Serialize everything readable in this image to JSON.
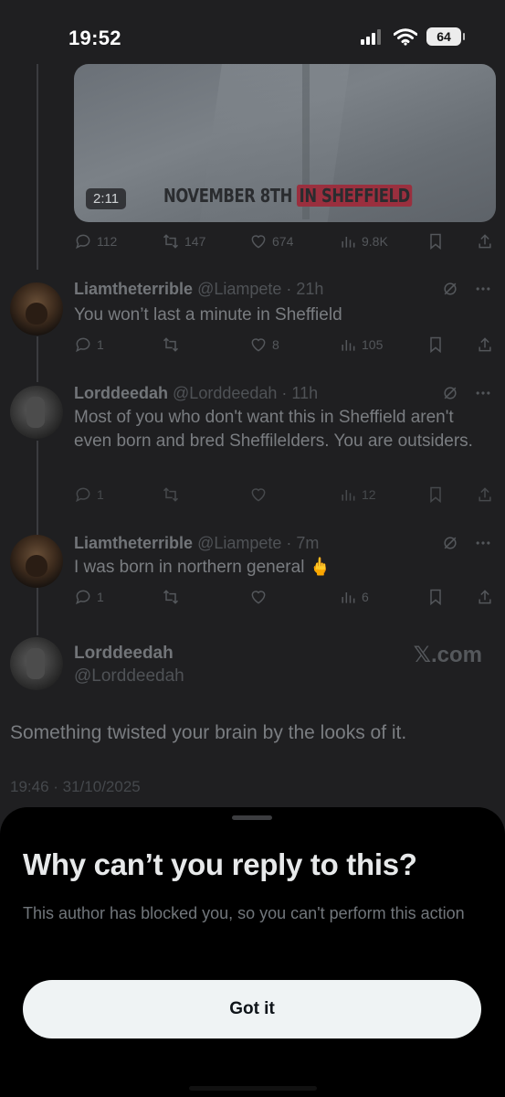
{
  "status_bar": {
    "time": "19:52",
    "battery": "64"
  },
  "video": {
    "duration": "2:11",
    "caption_part1": "NOVEMBER 8TH ",
    "caption_part2": "IN SHEFFIELD"
  },
  "video_actions": {
    "replies": "112",
    "reposts": "147",
    "likes": "674",
    "views": "9.8K"
  },
  "replies": [
    {
      "name": "Liamtheterrible",
      "handle": "@Liampete",
      "time": "21h",
      "text": "You won’t last a minute in Sheffield",
      "reply_count": "1",
      "repost_count": "",
      "like_count": "8",
      "view_count": "105"
    },
    {
      "name": "Lorddeedah",
      "handle": "@Lorddeedah",
      "time": "11h",
      "text": "Most of you who don't want this in Sheffield aren't even born and bred Sheffilelders. You are outsiders.",
      "reply_count": "1",
      "repost_count": "",
      "like_count": "",
      "view_count": "12"
    },
    {
      "name": "Liamtheterrible",
      "handle": "@Liampete",
      "time": "7m",
      "text": "I was born in northern general 🖕",
      "reply_count": "1",
      "repost_count": "",
      "like_count": "",
      "view_count": "6"
    }
  ],
  "main_tweet": {
    "name": "Lorddeedah",
    "handle": "@Lorddeedah",
    "source": "𝕏.com",
    "text": "Something twisted your brain by the looks of it.",
    "timestamp": "19:46 · 31/10/2025"
  },
  "sheet": {
    "title": "Why can’t you reply to this?",
    "description": "This author has blocked you, so you can't perform this action",
    "button_label": "Got it"
  },
  "icons": [
    "cellular-icon",
    "wifi-icon",
    "battery-icon",
    "reply-icon",
    "repost-icon",
    "like-icon",
    "views-icon",
    "bookmark-icon",
    "share-icon",
    "grok-icon",
    "more-icon"
  ],
  "colors": {
    "sheet_bg": "#000000",
    "button_bg": "#eff3f4",
    "backdrop": "#1f1f21"
  }
}
